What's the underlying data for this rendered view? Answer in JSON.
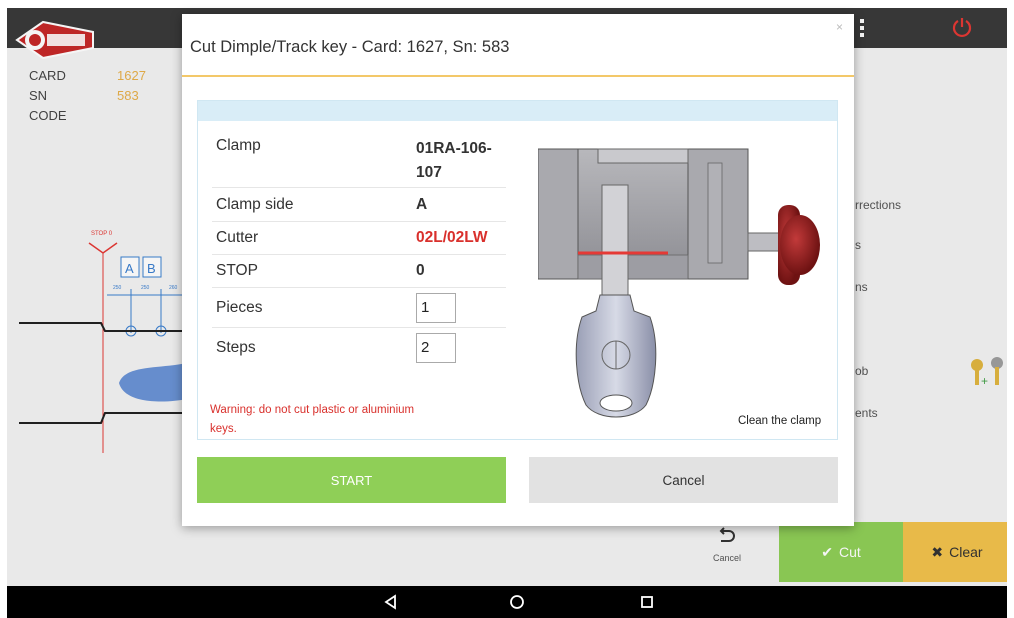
{
  "app": {
    "info": [
      {
        "label": "CARD",
        "value": "1627"
      },
      {
        "label": "SN",
        "value": "583"
      },
      {
        "label": "CODE",
        "value": ""
      }
    ],
    "diagram": {
      "stop_label": "STOP 0",
      "letters": [
        "A",
        "B"
      ],
      "dims": [
        "250",
        "250",
        "260"
      ]
    },
    "side_menu": [
      "rrections",
      "s",
      "ns",
      "ob",
      "ents"
    ],
    "cancel_label": "Cancel",
    "cut_label": "Cut",
    "clear_label": "Clear",
    "colors": {
      "green": "#8fcf57",
      "yellow": "#f2c24d",
      "topbar": "#3a3a3a",
      "red": "#d9302c"
    }
  },
  "modal": {
    "title": "Cut Dimple/Track key - Card: 1627, Sn: 583",
    "close": "×",
    "params": [
      {
        "key": "Clamp",
        "value": "01RA-106-107"
      },
      {
        "key": "Clamp side",
        "value": "A"
      },
      {
        "key": "Cutter",
        "value": "02L/02LW"
      },
      {
        "key": "STOP",
        "value": "0"
      },
      {
        "key": "Pieces",
        "value": "1"
      },
      {
        "key": "Steps",
        "value": "2"
      }
    ],
    "warning": "Warning: do not cut plastic or aluminium keys.",
    "image_caption": "Clean the clamp",
    "start_label": "START",
    "cancel_label": "Cancel"
  }
}
